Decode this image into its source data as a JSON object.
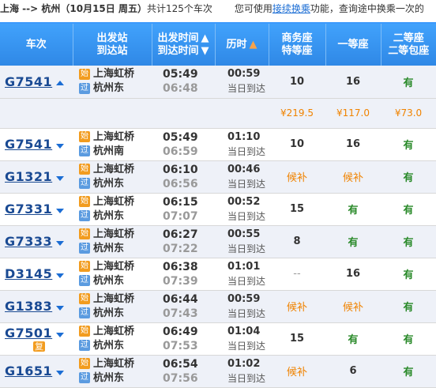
{
  "topbar": {
    "route": "上海 --> 杭州",
    "date": "（10月15日  周五）",
    "count_text": "共计125个车次",
    "hint_prefix": "您可使用",
    "hint_link": "接续换乘",
    "hint_suffix": "功能，查询途中换乘一次的"
  },
  "headers": {
    "train": "车次",
    "station_1": "出发站",
    "station_2": "到达站",
    "time_1": "出发时间",
    "time_2": "到达时间",
    "duration": "历时",
    "business_1": "商务座",
    "business_2": "特等座",
    "first": "一等座",
    "second_1": "二等座",
    "second_2": "二等包座"
  },
  "tags": {
    "start": "始",
    "pass": "过"
  },
  "trains": [
    {
      "no": "G7541",
      "from": "上海虹桥",
      "to": "杭州东",
      "dep": "05:49",
      "arr": "06:48",
      "dur": "00:59",
      "arrive_day": "当日到达",
      "business": "10",
      "first": "16",
      "second": "有",
      "expanded": true
    },
    {
      "no": "G7541",
      "from": "上海虹桥",
      "to": "杭州南",
      "dep": "05:49",
      "arr": "06:59",
      "dur": "01:10",
      "arrive_day": "当日到达",
      "business": "10",
      "first": "16",
      "second": "有"
    },
    {
      "no": "G1321",
      "from": "上海虹桥",
      "to": "杭州东",
      "dep": "06:10",
      "arr": "06:56",
      "dur": "00:46",
      "arrive_day": "当日到达",
      "business": "候补",
      "first": "候补",
      "second": "有"
    },
    {
      "no": "G7331",
      "from": "上海虹桥",
      "to": "杭州东",
      "dep": "06:15",
      "arr": "07:07",
      "dur": "00:52",
      "arrive_day": "当日到达",
      "business": "15",
      "first": "有",
      "second": "有"
    },
    {
      "no": "G7333",
      "from": "上海虹桥",
      "to": "杭州东",
      "dep": "06:27",
      "arr": "07:22",
      "dur": "00:55",
      "arrive_day": "当日到达",
      "business": "8",
      "first": "有",
      "second": "有"
    },
    {
      "no": "D3145",
      "from": "上海虹桥",
      "to": "杭州东",
      "dep": "06:38",
      "arr": "07:39",
      "dur": "01:01",
      "arrive_day": "当日到达",
      "business": "--",
      "first": "16",
      "second": "有"
    },
    {
      "no": "G1383",
      "from": "上海虹桥",
      "to": "杭州东",
      "dep": "06:44",
      "arr": "07:43",
      "dur": "00:59",
      "arrive_day": "当日到达",
      "business": "候补",
      "first": "候补",
      "second": "有"
    },
    {
      "no": "G7501",
      "from": "上海虹桥",
      "to": "杭州东",
      "dep": "06:49",
      "arr": "07:53",
      "dur": "01:04",
      "arrive_day": "当日到达",
      "business": "15",
      "first": "有",
      "second": "有",
      "badge": "复"
    },
    {
      "no": "G1651",
      "from": "上海虹桥",
      "to": "杭州东",
      "dep": "06:54",
      "arr": "07:56",
      "dur": "01:02",
      "arrive_day": "当日到达",
      "business": "候补",
      "first": "6",
      "second": "有"
    }
  ],
  "price_row": {
    "business": "¥219.5",
    "first": "¥117.0",
    "second": "¥73.0"
  },
  "colors": {
    "header_blue": "#3b99fc",
    "train_link": "#1a4a93",
    "available_green": "#2a8a2a",
    "waitlist_orange": "#f08300"
  }
}
